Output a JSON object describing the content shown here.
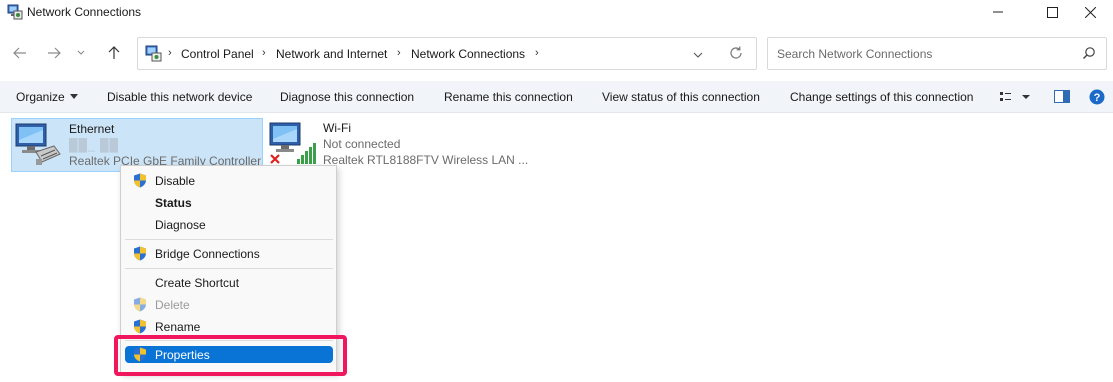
{
  "window": {
    "title": "Network Connections",
    "icon": "network-connections-icon",
    "controls": {
      "minimize": "minimize-icon",
      "maximize": "maximize-icon",
      "close": "close-icon"
    }
  },
  "nav": {
    "back": "arrow-left-icon",
    "forward": "arrow-right-icon",
    "recent": "chevron-down-icon",
    "up": "arrow-up-icon"
  },
  "address": {
    "crumbs": [
      "Control Panel",
      "Network and Internet",
      "Network Connections"
    ],
    "separator": "›",
    "refresh": "refresh-icon",
    "dropdown": "chevron-down-icon"
  },
  "search": {
    "placeholder": "Search Network Connections",
    "icon": "search-icon"
  },
  "toolbar": {
    "organize": "Organize",
    "items": [
      "Disable this network device",
      "Diagnose this connection",
      "Rename this connection",
      "View status of this connection",
      "Change settings of this connection"
    ],
    "icons": [
      "view-options-icon",
      "preview-pane-icon",
      "help-icon"
    ]
  },
  "connections": [
    {
      "name": "Ethernet",
      "status": "██_ ██",
      "adapter": "Realtek PCIe GbE Family Controller",
      "selected": true
    },
    {
      "name": "Wi-Fi",
      "status": "Not connected",
      "adapter": "Realtek RTL8188FTV Wireless LAN ...",
      "selected": false
    }
  ],
  "context_menu": {
    "items": [
      {
        "label": "Disable",
        "shield": true,
        "bold": false,
        "disabled": false
      },
      {
        "label": "Status",
        "shield": false,
        "bold": true,
        "disabled": false
      },
      {
        "label": "Diagnose",
        "shield": false,
        "bold": false,
        "disabled": false
      },
      {
        "label": "Bridge Connections",
        "shield": true,
        "bold": false,
        "disabled": false
      },
      {
        "label": "Create Shortcut",
        "shield": false,
        "bold": false,
        "disabled": false
      },
      {
        "label": "Delete",
        "shield": true,
        "bold": false,
        "disabled": true
      },
      {
        "label": "Rename",
        "shield": true,
        "bold": false,
        "disabled": false
      },
      {
        "label": "Properties",
        "shield": true,
        "bold": false,
        "disabled": false,
        "highlighted": true
      }
    ]
  },
  "colors": {
    "accent": "#0a74d6",
    "selection": "#cce4f7",
    "callout": "#f0175e",
    "commandbar": "#f1f4f8"
  }
}
